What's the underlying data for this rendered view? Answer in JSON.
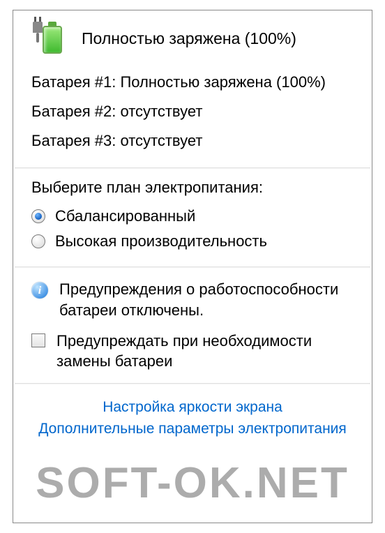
{
  "header": {
    "title": "Полностью заряжена (100%)"
  },
  "batteries": {
    "b1": "Батарея #1: Полностью заряжена (100%)",
    "b2": "Батарея #2: отсутствует",
    "b3": "Батарея #3: отсутствует"
  },
  "plan": {
    "prompt": "Выберите план электропитания:",
    "option1": "Сбалансированный",
    "option2": "Высокая производительность",
    "selected": 1
  },
  "info": {
    "text": "Предупреждения о работоспособности батареи отключены."
  },
  "checkbox": {
    "label": "Предупреждать при необходимости замены батареи",
    "checked": false
  },
  "links": {
    "brightness": "Настройка яркости экрана",
    "more": "Дополнительные параметры электропитания"
  },
  "watermark": "SOFT-OK.NET"
}
